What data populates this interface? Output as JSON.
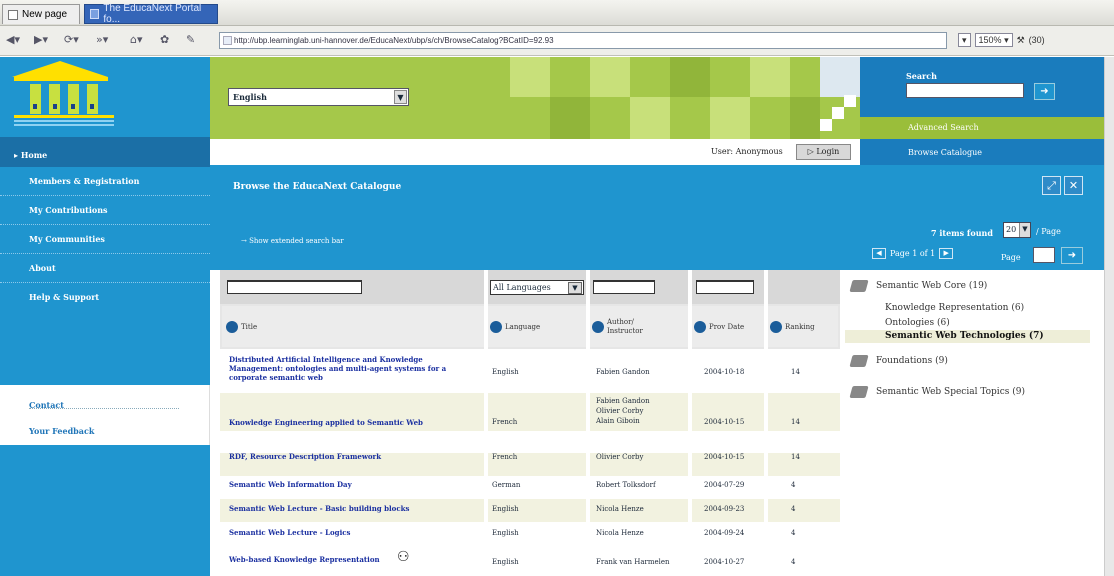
{
  "browser": {
    "tabs": [
      {
        "label": "New page"
      },
      {
        "label": "The EducaNext Portal fo..."
      }
    ],
    "url": "http://ubp.learninglab.uni-hannover.de/EducaNext/ubp/s/ch/BrowseCatalog?BCatID=92.93",
    "zoom": "150%",
    "extra": "(30)"
  },
  "header": {
    "language_value": "English",
    "user_label": "User: Anonymous",
    "login_label": "Login",
    "search_label": "Search",
    "search_value": "",
    "advanced_search": "Advanced Search",
    "browse_catalogue": "Browse Catalogue"
  },
  "sidebar": {
    "home": "Home",
    "items": [
      {
        "label": "Members & Registration"
      },
      {
        "label": "My Contributions"
      },
      {
        "label": "My Communities"
      },
      {
        "label": "About"
      },
      {
        "label": "Help & Support"
      }
    ],
    "footer": [
      {
        "label": "Contact"
      },
      {
        "label": "Your Feedback"
      }
    ]
  },
  "content": {
    "title": "Browse the EducaNext Catalogue",
    "show_extended": "Show extended search bar",
    "items_found": "7 items found",
    "per_page_value": "20",
    "per_page_label": "/ Page",
    "pager_text": "Page 1 of 1",
    "page_label": "Page",
    "page_value": ""
  },
  "table": {
    "language_filter": "All Languages",
    "columns": [
      {
        "label": "Title"
      },
      {
        "label": "Language"
      },
      {
        "label": "Author/ Instructor"
      },
      {
        "label": "Prov Date"
      },
      {
        "label": "Ranking"
      }
    ],
    "rows": [
      {
        "title": "Distributed Artificial Intelligence and Knowledge Management: ontologies and multi-agent systems for a corporate semantic web",
        "language": "English",
        "author": "Fabien Gandon",
        "date": "2004-10-18",
        "ranking": "14"
      },
      {
        "title": "Knowledge Engineering applied to Semantic Web",
        "language": "French",
        "author": "Fabien Gandon Olivier Corby Alain Giboin",
        "date": "2004-10-15",
        "ranking": "14"
      },
      {
        "title": "RDF, Resource Description Framework",
        "language": "French",
        "author": "Olivier Corby",
        "date": "2004-10-15",
        "ranking": "14"
      },
      {
        "title": "Semantic Web Information Day",
        "language": "German",
        "author": "Robert Tolksdorf",
        "date": "2004-07-29",
        "ranking": "4"
      },
      {
        "title": "Semantic Web Lecture - Basic building blocks",
        "language": "English",
        "author": "Nicola Henze",
        "date": "2004-09-23",
        "ranking": "4"
      },
      {
        "title": "Semantic Web Lecture - Logics",
        "language": "English",
        "author": "Nicola Henze",
        "date": "2004-09-24",
        "ranking": "4"
      },
      {
        "title": "Web-based Knowledge Representation",
        "language": "English",
        "author": "Frank van Harmelen",
        "date": "2004-10-27",
        "ranking": "4"
      }
    ]
  },
  "tree": {
    "nodes": [
      {
        "label": "Semantic Web Core (19)"
      },
      {
        "label": "Foundations (9)"
      },
      {
        "label": "Semantic Web Special Topics (9)"
      }
    ],
    "children": [
      {
        "label": "Knowledge Representation (6)"
      },
      {
        "label": "Ontologies (6)"
      },
      {
        "label": "Semantic Web Technologies (7)"
      }
    ]
  }
}
